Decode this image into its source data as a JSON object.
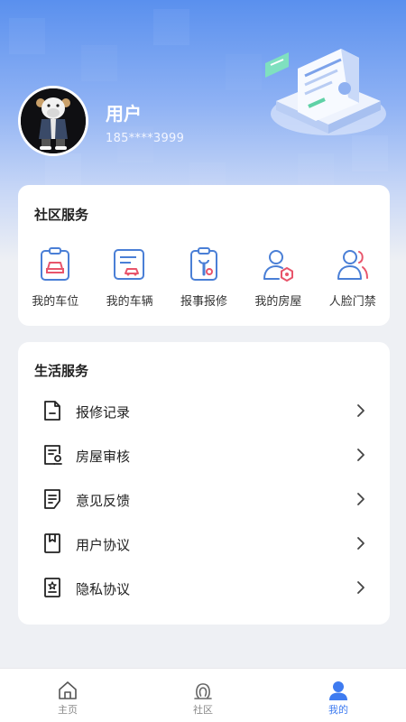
{
  "header": {
    "user_name": "用户",
    "phone": "185****3999"
  },
  "community_services": {
    "title": "社区服务",
    "items": [
      {
        "label": "我的车位",
        "icon": "parking-space-icon"
      },
      {
        "label": "我的车辆",
        "icon": "vehicle-icon"
      },
      {
        "label": "报事报修",
        "icon": "repair-report-icon"
      },
      {
        "label": "我的房屋",
        "icon": "my-house-icon"
      },
      {
        "label": "人脸门禁",
        "icon": "face-access-icon"
      }
    ]
  },
  "life_services": {
    "title": "生活服务",
    "items": [
      {
        "label": "报修记录",
        "icon": "repair-record-icon"
      },
      {
        "label": "房屋审核",
        "icon": "house-review-icon"
      },
      {
        "label": "意见反馈",
        "icon": "feedback-icon"
      },
      {
        "label": "用户协议",
        "icon": "user-agreement-icon"
      },
      {
        "label": "隐私协议",
        "icon": "privacy-agreement-icon"
      }
    ]
  },
  "tabbar": {
    "items": [
      {
        "label": "主页",
        "icon": "home-icon",
        "active": false
      },
      {
        "label": "社区",
        "icon": "community-icon",
        "active": false
      },
      {
        "label": "我的",
        "icon": "profile-icon",
        "active": true
      }
    ]
  },
  "colors": {
    "accent": "#3e7bf0",
    "icon_blue": "#4a7fd6",
    "icon_red": "#e8556b",
    "header_top": "#5a90ee"
  }
}
